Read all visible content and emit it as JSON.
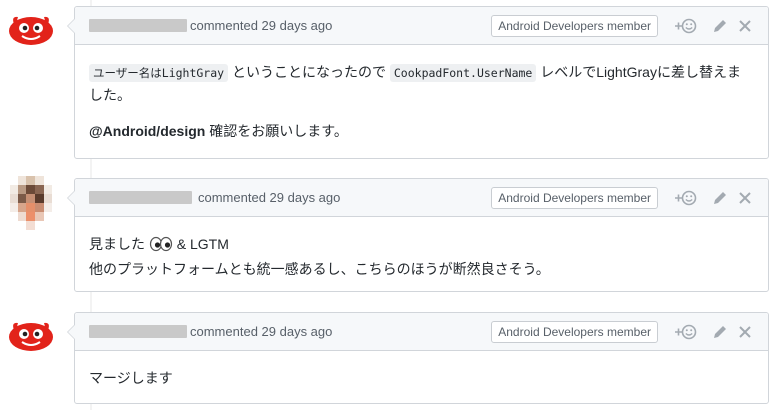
{
  "comments": [
    {
      "commented_label": "commented 29 days ago",
      "badge": "Android Developers member",
      "body_parts": {
        "code1": "ユーザー名はLightGray",
        "text1": " ということになったので ",
        "code2": "CookpadFont.UserName",
        "text2": " レベルでLightGrayに差し替えました。",
        "mention": "@Android/design",
        "text3": " 確認をお願いします。"
      }
    },
    {
      "commented_label": "commented 29 days ago",
      "badge": "Android Developers member",
      "body_line1": "見ました",
      "body_line1_tail": " & LGTM",
      "body_line2": "他のプラットフォームとも統一感あるし、こちらのほうが断然良さそう。"
    },
    {
      "commented_label": "commented 29 days ago",
      "badge": "Android Developers member",
      "body_line1": "マージします"
    }
  ],
  "icons": {
    "add_reaction": "add-reaction-icon",
    "edit": "pencil-icon",
    "delete": "close-icon",
    "eyes": "eyes-emoji-icon"
  },
  "colors": {
    "header_bg": "#f6f8fa",
    "border": "#d1d5da",
    "muted": "#586069",
    "icon": "#a3aab1"
  }
}
